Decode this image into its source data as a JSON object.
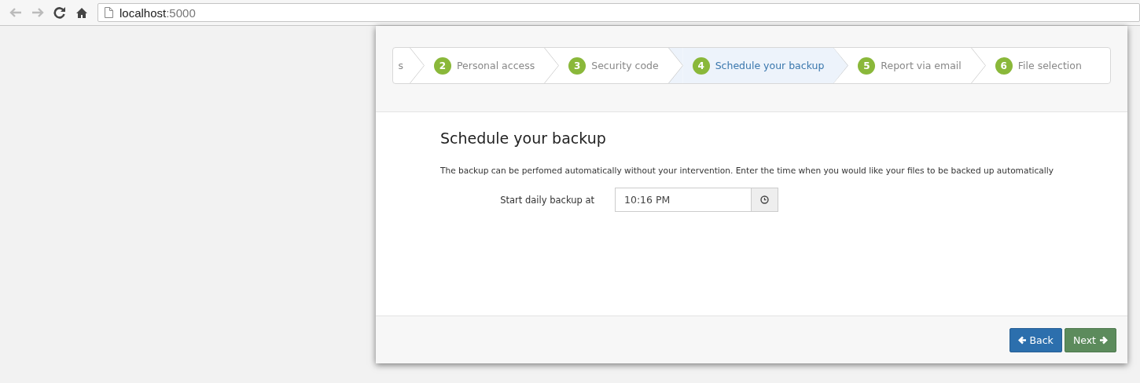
{
  "browser": {
    "address": {
      "host": "localhost",
      "port": ":5000"
    }
  },
  "steps": [
    {
      "label": "s",
      "selected": false
    },
    {
      "number": "2",
      "label": "Personal access",
      "selected": false
    },
    {
      "number": "3",
      "label": "Security code",
      "selected": false
    },
    {
      "number": "4",
      "label": "Schedule your backup",
      "selected": true
    },
    {
      "number": "5",
      "label": "Report via email",
      "selected": false
    },
    {
      "number": "6",
      "label": "File selection",
      "selected": false
    }
  ],
  "content": {
    "heading": "Schedule your backup",
    "description": "The backup can be perfomed automatically without your intervention. Enter the time when you would like your files to be backed up automatically",
    "field": {
      "label": "Start daily backup at",
      "value": "10:16 PM"
    }
  },
  "buttons": [
    {
      "kind": "back",
      "label": "Back"
    },
    {
      "kind": "next",
      "label": "Next"
    }
  ]
}
